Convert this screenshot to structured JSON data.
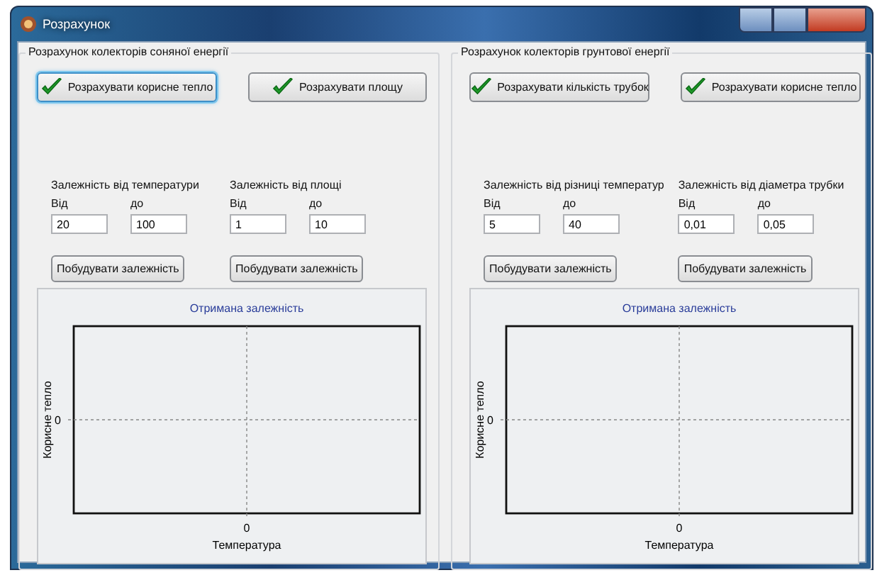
{
  "window": {
    "title": "Розрахунок"
  },
  "groups": [
    {
      "title": "Розрахунок колекторів соняної енергії",
      "buttons": [
        {
          "label": "Розрахувати корисне тепло",
          "focused": true
        },
        {
          "label": "Розрахувати площу",
          "focused": false
        }
      ],
      "params": [
        {
          "title": "Залежність від температури",
          "from_label": "Від",
          "to_label": "до",
          "from": "20",
          "to": "100",
          "build": "Побудувати залежність"
        },
        {
          "title": "Залежність від площі",
          "from_label": "Від",
          "to_label": "до",
          "from": "1",
          "to": "10",
          "build": "Побудувати залежність"
        }
      ],
      "chart": {
        "title": "Отримана залежність",
        "xlabel": "Температура",
        "ylabel": "Корисне тепло",
        "xtick": "0",
        "ytick": "0"
      }
    },
    {
      "title": "Розрахунок колекторів грунтової енергії",
      "buttons": [
        {
          "label": "Розрахувати кількість трубок",
          "focused": false
        },
        {
          "label": "Розрахувати корисне тепло",
          "focused": false
        }
      ],
      "params": [
        {
          "title": "Залежність від різниці температур",
          "from_label": "Від",
          "to_label": "до",
          "from": "5",
          "to": "40",
          "build": "Побудувати залежність"
        },
        {
          "title": "Залежність від діаметра трубки",
          "from_label": "Від",
          "to_label": "до",
          "from": "0,01",
          "to": "0,05",
          "build": "Побудувати залежність"
        }
      ],
      "chart": {
        "title": "Отримана залежність",
        "xlabel": "Температура",
        "ylabel": "Корисне тепло",
        "xtick": "0",
        "ytick": "0"
      }
    }
  ]
}
